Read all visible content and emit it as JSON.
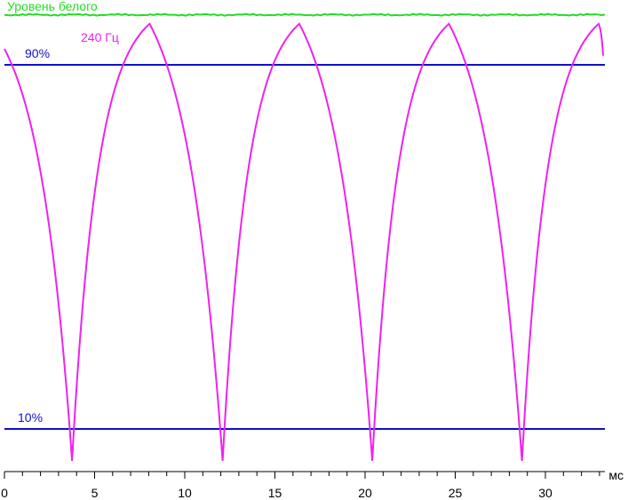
{
  "chart_data": {
    "type": "line",
    "xlabel": "мс",
    "ylabel": "",
    "xlim": [
      0,
      33.3
    ],
    "ylim": [
      0,
      110
    ],
    "grid": false,
    "x_ticks": [
      0,
      5,
      10,
      15,
      20,
      25,
      30
    ],
    "annotations": {
      "white_level_label": "Уровень белого",
      "frequency_label": "240 Гц",
      "p90_label": "90%",
      "p10_label": "10%"
    },
    "reference_lines": [
      {
        "label": "90%",
        "value": 90,
        "color": "#1010c8"
      },
      {
        "label": "10%",
        "value": 10,
        "color": "#1010c8"
      },
      {
        "label": "Уровень белого",
        "value": 101,
        "color": "#22dd22"
      }
    ],
    "series": [
      {
        "name": "240 Гц",
        "color": "#ee22ee",
        "points": [
          [
            0.0,
            93.5
          ],
          [
            3.75,
            3.0
          ],
          [
            8.05,
            99.0
          ],
          [
            12.1,
            3.0
          ],
          [
            16.35,
            99.0
          ],
          [
            20.4,
            3.0
          ],
          [
            24.65,
            99.0
          ],
          [
            28.7,
            3.0
          ],
          [
            32.95,
            99.0
          ],
          [
            33.2,
            92.0
          ]
        ]
      }
    ]
  }
}
